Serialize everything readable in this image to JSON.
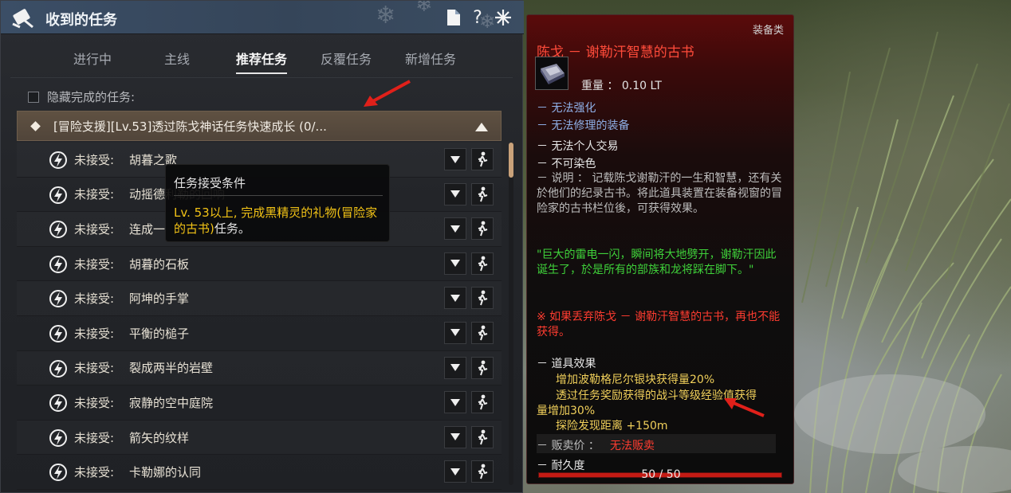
{
  "window": {
    "title": "收到的任务",
    "help_label": "?"
  },
  "tabs": [
    {
      "label": "进行中"
    },
    {
      "label": "主线"
    },
    {
      "label": "推荐任务"
    },
    {
      "label": "反覆任务"
    },
    {
      "label": "新增任务"
    }
  ],
  "hide_completed_label": "隐藏完成的任务:",
  "group": {
    "title": "[冒险支援][Lv.53]透过陈戈神话任务快速成长 (0/..."
  },
  "quests": [
    {
      "status": "未接受:",
      "name": "胡暮之歌"
    },
    {
      "status": "未接受:",
      "name": "动摇德利勒的回响"
    },
    {
      "status": "未接受:",
      "name": "连成一"
    },
    {
      "status": "未接受:",
      "name": "胡暮的石板"
    },
    {
      "status": "未接受:",
      "name": "阿坤的手掌"
    },
    {
      "status": "未接受:",
      "name": "平衡的槌子"
    },
    {
      "status": "未接受:",
      "name": "裂成两半的岩壁"
    },
    {
      "status": "未接受:",
      "name": "寂静的空中庭院"
    },
    {
      "status": "未接受:",
      "name": "箭矢的纹样"
    },
    {
      "status": "未接受:",
      "name": "卡勒娜的认同"
    }
  ],
  "quest_tooltip": {
    "title": "任务接受条件",
    "prefix": "Lv. 53以上, 完成",
    "highlight": "黑精灵的礼物(冒险家的古书)",
    "suffix": "任务。"
  },
  "item": {
    "category": "装备类",
    "name": "陈戈 － 谢勒汗智慧的古书",
    "weight": "重量 ： 0.10 LT",
    "no_enhance": "－ 无法强化",
    "no_repair": "－ 无法修理的装备",
    "no_trade": "－ 无法个人交易",
    "no_dye": "－ 不可染色",
    "description": "－ 说明 ： 记载陈戈谢勒汗的一生和智慧，还有关於他们的纪录古书。将此道具装置在装备视窗的冒险家的古书栏位後，可获得效果。",
    "quote": "\"巨大的雷电一闪，瞬间将大地劈开，谢勒汗因此诞生了，於是所有的部族和龙将踩在脚下。\"",
    "warning": "※  如果丢弃陈戈 － 谢勒汗智慧的古书，再也不能获得。",
    "effects_title": "－ 道具效果",
    "effect_1": "增加波勒格尼尔银块获得量20%",
    "effect_2_line1": "透过任务奖励获得的战斗等级经验值获得",
    "effect_2_line2": "量增加30%",
    "effect_3": "探险发现距离  +150m",
    "sell_label": "－ 贩卖价 ：",
    "sell_value": "无法贩卖",
    "durability_label": "－ 耐久度",
    "durability_text": "50  /  50",
    "durability_fraction": 1.0
  },
  "colors": {
    "item_name": "#ff4b3a",
    "highlight_yellow": "#f2c316",
    "scroll_thumb": "#c9a27a",
    "annotation_arrow": "#e0201a"
  }
}
